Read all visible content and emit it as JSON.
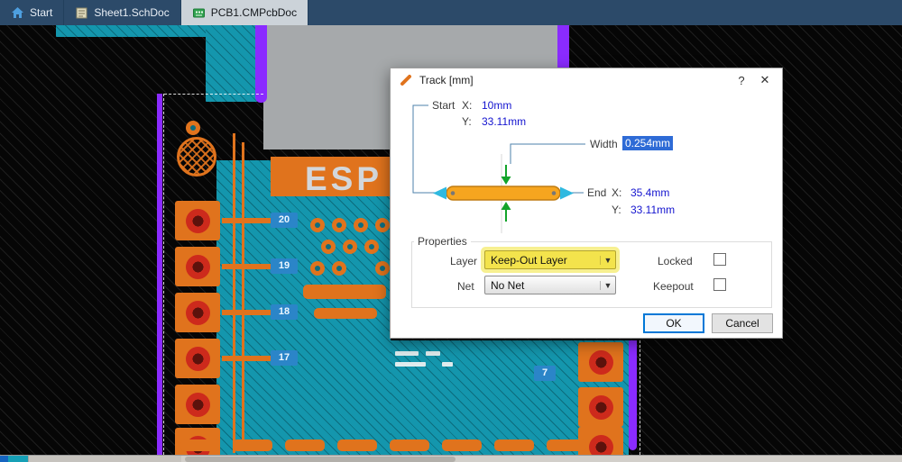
{
  "tab_bar": {
    "tabs": [
      {
        "label": "Start",
        "icon": "home-icon",
        "active": false
      },
      {
        "label": "Sheet1.SchDoc",
        "icon": "schematic-doc-icon",
        "active": false
      },
      {
        "label": "PCB1.CMPcbDoc",
        "icon": "pcb-doc-icon",
        "active": true
      }
    ]
  },
  "pcb": {
    "silkscreen": "ESP",
    "pin_labels": [
      "20",
      "19",
      "18",
      "17"
    ],
    "pin_label_right": "7"
  },
  "dialog": {
    "title": "Track [mm]",
    "help_label": "?",
    "close_label": "✕",
    "start": {
      "label": "Start",
      "x_label": "X:",
      "x_value": "10mm",
      "y_label": "Y:",
      "y_value": "33.11mm"
    },
    "width": {
      "label": "Width",
      "value": "0.254mm"
    },
    "end": {
      "label": "End",
      "x_label": "X:",
      "x_value": "35.4mm",
      "y_label": "Y:",
      "y_value": "33.11mm"
    },
    "properties": {
      "legend": "Properties",
      "layer_label": "Layer",
      "layer_value": "Keep-Out Layer",
      "net_label": "Net",
      "net_value": "No Net",
      "locked_label": "Locked",
      "locked_checked": false,
      "keepout_label": "Keepout",
      "keepout_checked": false
    },
    "buttons": {
      "ok": "OK",
      "cancel": "Cancel"
    }
  },
  "colors": {
    "copper_orange": "#e0731d",
    "plane_teal": "#1496ad",
    "keepout_purple": "#8a2bff",
    "pad_red": "#cd2a1c",
    "value_blue": "#1414cf",
    "selection_blue": "#2e6bd6",
    "highlight_yellow": "#f3e34c",
    "ok_focus_blue": "#0078d7",
    "tab_bar_navy": "#2c4a69"
  }
}
